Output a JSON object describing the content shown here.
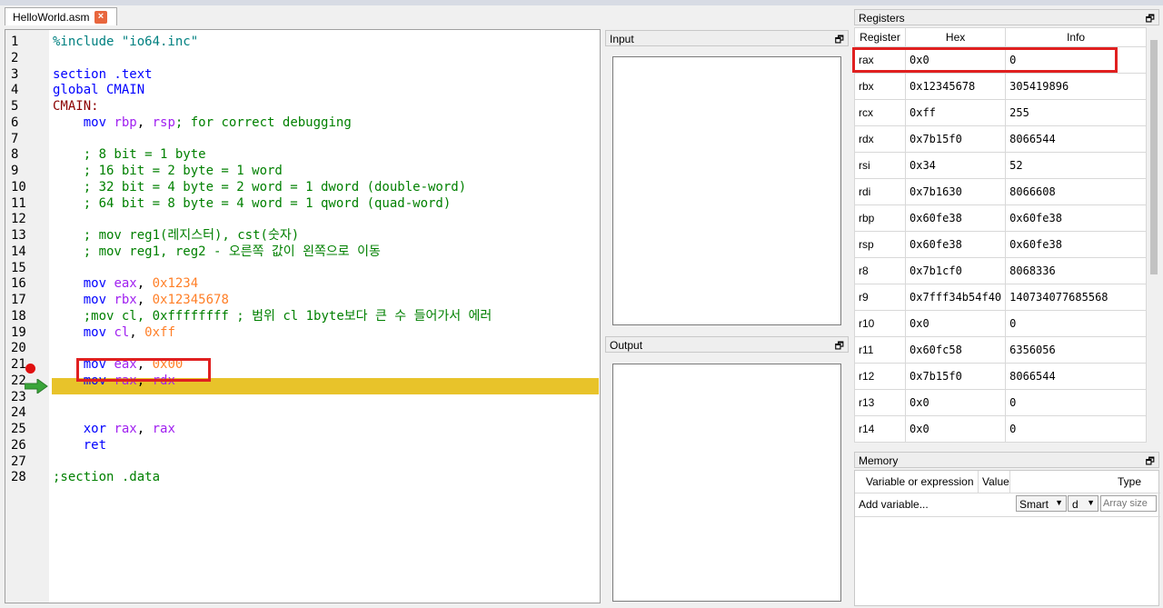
{
  "tab": {
    "filename": "HelloWorld.asm",
    "close_glyph": "×"
  },
  "editor": {
    "lines": [
      {
        "n": "1",
        "segments": [
          [
            "str",
            "%include \"io64.inc\""
          ]
        ]
      },
      {
        "n": "2",
        "segments": []
      },
      {
        "n": "3",
        "segments": [
          [
            "kw",
            "section .text"
          ]
        ]
      },
      {
        "n": "4",
        "segments": [
          [
            "kw",
            "global CMAIN"
          ]
        ]
      },
      {
        "n": "5",
        "segments": [
          [
            "lbl",
            "CMAIN:"
          ]
        ]
      },
      {
        "n": "6",
        "segments": [
          [
            "plain",
            "    "
          ],
          [
            "kw",
            "mov "
          ],
          [
            "reg",
            "rbp"
          ],
          [
            "plain",
            ", "
          ],
          [
            "reg",
            "rsp"
          ],
          [
            "cmt",
            "; for correct debugging"
          ]
        ]
      },
      {
        "n": "7",
        "segments": []
      },
      {
        "n": "8",
        "segments": [
          [
            "cmt",
            "    ; 8 bit = 1 byte"
          ]
        ]
      },
      {
        "n": "9",
        "segments": [
          [
            "cmt",
            "    ; 16 bit = 2 byte = 1 word"
          ]
        ]
      },
      {
        "n": "10",
        "segments": [
          [
            "cmt",
            "    ; 32 bit = 4 byte = 2 word = 1 dword (double-word)"
          ]
        ]
      },
      {
        "n": "11",
        "segments": [
          [
            "cmt",
            "    ; 64 bit = 8 byte = 4 word = 1 qword (quad-word)"
          ]
        ]
      },
      {
        "n": "12",
        "segments": []
      },
      {
        "n": "13",
        "segments": [
          [
            "cmt",
            "    ; mov reg1(레지스터), cst(숫자)"
          ]
        ]
      },
      {
        "n": "14",
        "segments": [
          [
            "cmt",
            "    ; mov reg1, reg2 - 오른쪽 값이 왼쪽으로 이동"
          ]
        ]
      },
      {
        "n": "15",
        "segments": []
      },
      {
        "n": "16",
        "segments": [
          [
            "plain",
            "    "
          ],
          [
            "kw",
            "mov "
          ],
          [
            "reg",
            "eax"
          ],
          [
            "plain",
            ", "
          ],
          [
            "num",
            "0x1234"
          ]
        ]
      },
      {
        "n": "17",
        "segments": [
          [
            "plain",
            "    "
          ],
          [
            "kw",
            "mov "
          ],
          [
            "reg",
            "rbx"
          ],
          [
            "plain",
            ", "
          ],
          [
            "num",
            "0x12345678"
          ]
        ]
      },
      {
        "n": "18",
        "segments": [
          [
            "cmt",
            "    ;mov cl, 0xffffffff ; 범위 cl 1byte보다 큰 수 들어가서 에러"
          ]
        ]
      },
      {
        "n": "19",
        "segments": [
          [
            "plain",
            "    "
          ],
          [
            "kw",
            "mov "
          ],
          [
            "reg",
            "cl"
          ],
          [
            "plain",
            ", "
          ],
          [
            "num",
            "0xff"
          ]
        ]
      },
      {
        "n": "20",
        "segments": []
      },
      {
        "n": "21",
        "segments": [
          [
            "plain",
            "    "
          ],
          [
            "kw",
            "mov "
          ],
          [
            "reg",
            "eax"
          ],
          [
            "plain",
            ", "
          ],
          [
            "num",
            "0x00"
          ]
        ]
      },
      {
        "n": "22",
        "segments": [
          [
            "plain",
            "    "
          ],
          [
            "kw",
            "mov "
          ],
          [
            "reg",
            "rax"
          ],
          [
            "plain",
            ", "
          ],
          [
            "reg",
            "rdx"
          ]
        ]
      },
      {
        "n": "23",
        "segments": []
      },
      {
        "n": "24",
        "segments": []
      },
      {
        "n": "25",
        "segments": [
          [
            "plain",
            "    "
          ],
          [
            "kw",
            "xor "
          ],
          [
            "reg",
            "rax"
          ],
          [
            "plain",
            ", "
          ],
          [
            "reg",
            "rax"
          ]
        ]
      },
      {
        "n": "26",
        "segments": [
          [
            "plain",
            "    "
          ],
          [
            "kw",
            "ret"
          ]
        ]
      },
      {
        "n": "27",
        "segments": []
      },
      {
        "n": "28",
        "segments": [
          [
            "cmt",
            ";section .data"
          ]
        ]
      }
    ],
    "colors": {
      "highlight": "#e8c32a",
      "keyword": "#0000ff",
      "register": "#a020f0",
      "number": "#ff7f27",
      "comment": "#008000"
    },
    "breakpoint_line": "21",
    "current_line": "22"
  },
  "input_pane": {
    "title": "Input",
    "restore_glyph": "🗗"
  },
  "output_pane": {
    "title": "Output",
    "restore_glyph": "🗗"
  },
  "registers": {
    "title": "Registers",
    "restore_glyph": "🗗",
    "headers": [
      "Register",
      "Hex",
      "Info"
    ],
    "rows": [
      [
        "rax",
        "0x0",
        "0"
      ],
      [
        "rbx",
        "0x12345678",
        "305419896"
      ],
      [
        "rcx",
        "0xff",
        "255"
      ],
      [
        "rdx",
        "0x7b15f0",
        "8066544"
      ],
      [
        "rsi",
        "0x34",
        "52"
      ],
      [
        "rdi",
        "0x7b1630",
        "8066608"
      ],
      [
        "rbp",
        "0x60fe38",
        "0x60fe38"
      ],
      [
        "rsp",
        "0x60fe38",
        "0x60fe38"
      ],
      [
        "r8",
        "0x7b1cf0",
        "8068336"
      ],
      [
        "r9",
        "0x7fff34b54f40",
        "140734077685568"
      ],
      [
        "r10",
        "0x0",
        "0"
      ],
      [
        "r11",
        "0x60fc58",
        "6356056"
      ],
      [
        "r12",
        "0x7b15f0",
        "8066544"
      ],
      [
        "r13",
        "0x0",
        "0"
      ],
      [
        "r14",
        "0x0",
        "0"
      ]
    ]
  },
  "memory": {
    "title": "Memory",
    "restore_glyph": "🗗",
    "col_variable": "Variable or expression",
    "col_value": "Value",
    "col_type": "Type",
    "add_variable": "Add variable...",
    "type_select": "Smart",
    "size_select": "d",
    "array_placeholder": "Array size"
  }
}
